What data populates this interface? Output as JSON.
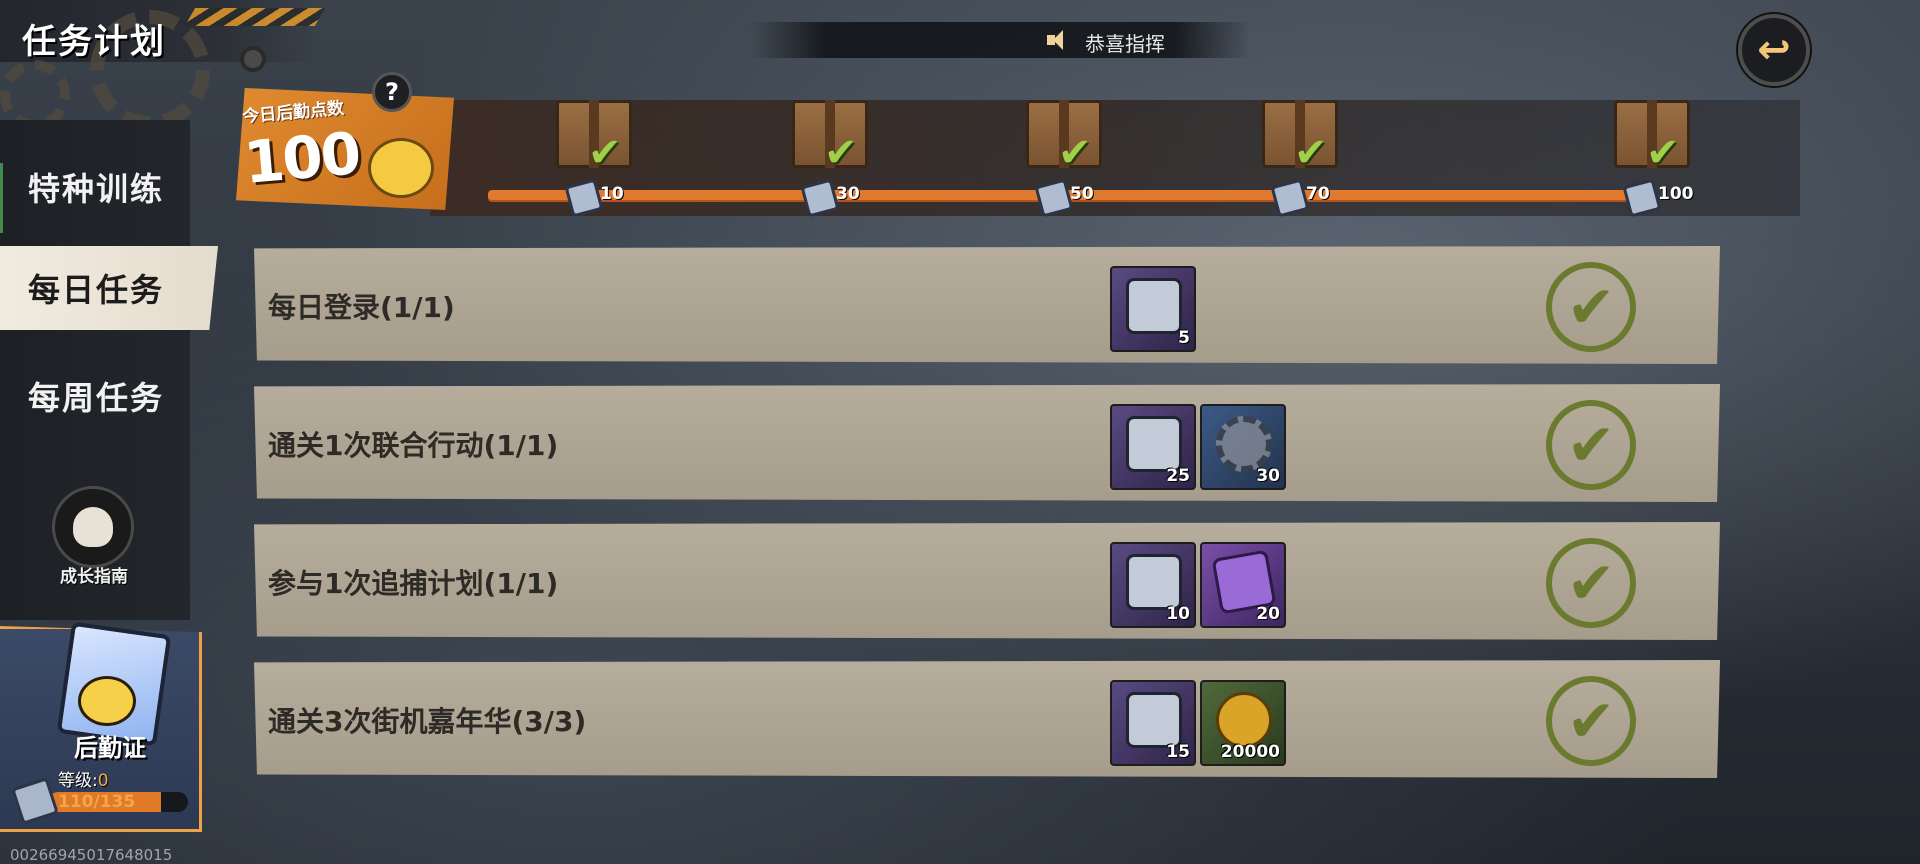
{
  "header": {
    "title": "任务计划",
    "announcement": "恭喜指挥"
  },
  "sidebar": {
    "tabs": [
      {
        "label": "特种训练"
      },
      {
        "label": "每日任务",
        "selected": true
      },
      {
        "label": "每周任务"
      }
    ],
    "guide_label": "成长指南"
  },
  "card": {
    "title": "后勤证",
    "level_label": "等级:",
    "level_value": "0",
    "xp_text": "110/135",
    "xp_fraction": 0.81
  },
  "points": {
    "label": "今日后勤点数",
    "value": "100",
    "help": "?"
  },
  "milestones": [
    {
      "value": "10",
      "claimed": true
    },
    {
      "value": "30",
      "claimed": true
    },
    {
      "value": "50",
      "claimed": true
    },
    {
      "value": "70",
      "claimed": true
    },
    {
      "value": "100",
      "claimed": true
    }
  ],
  "tasks": [
    {
      "name": "每日登录(1/1)",
      "rewards": [
        {
          "type": "logistics-token",
          "qty": "5"
        }
      ],
      "completed": true
    },
    {
      "name": "通关1次联合行动(1/1)",
      "rewards": [
        {
          "type": "logistics-token",
          "qty": "25"
        },
        {
          "type": "gear-material",
          "qty": "30"
        }
      ],
      "completed": true
    },
    {
      "name": "参与1次追捕计划(1/1)",
      "rewards": [
        {
          "type": "logistics-token",
          "qty": "10"
        },
        {
          "type": "weapon-manual",
          "qty": "20"
        }
      ],
      "completed": true
    },
    {
      "name": "通关3次街机嘉年华(3/3)",
      "rewards": [
        {
          "type": "logistics-token",
          "qty": "15"
        },
        {
          "type": "gold-coin",
          "qty": "20000"
        }
      ],
      "completed": true
    }
  ],
  "footer": {
    "watermark": "0026694501764801​5"
  },
  "colors": {
    "accent": "#e07a2e",
    "check": "#6a7a2e",
    "row_bg": "#b7ad9d"
  }
}
